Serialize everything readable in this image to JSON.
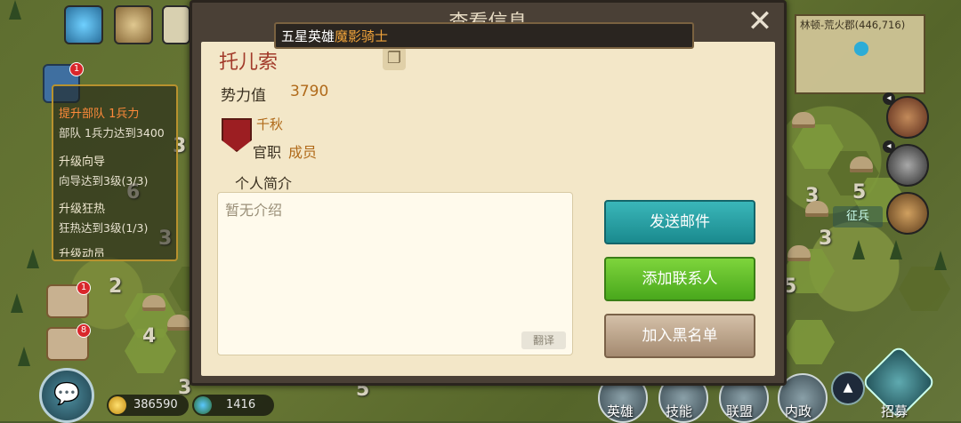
{
  "map": {
    "minimap_title": "林顿-荒火郡(446,716)",
    "tile_numbers": [
      "3",
      "6",
      "3",
      "2",
      "4",
      "3",
      "5",
      "3",
      "5",
      "5",
      "3"
    ],
    "recruit_tag": "征兵"
  },
  "quests": {
    "items": [
      {
        "title": "提升部队 1兵力",
        "detail": "部队 1兵力达到3400"
      },
      {
        "title": "升级向导",
        "detail": "向导达到3级(3/3)"
      },
      {
        "title": "升级狂热",
        "detail": "狂热达到3级(1/3)"
      },
      {
        "title": "升级动员",
        "detail": ""
      }
    ],
    "badge_count": "1"
  },
  "side": {
    "mail_badge": "1",
    "battle_badge": "8"
  },
  "resources": {
    "gold": "386590",
    "gems": "1416"
  },
  "bottom_bar": {
    "hero": "英雄",
    "skill": "技能",
    "alliance": "联盟",
    "internal": "内政",
    "recruit": "招募"
  },
  "dialog": {
    "title": "查看信息",
    "close": "✕",
    "name_bar_prefix": "五星英雄",
    "name_bar_highlight": "魔影骑士",
    "player_name": "托儿索",
    "power_label": "势力值",
    "power_value": "3790",
    "guild_name": "千秋",
    "rank_label": "官职",
    "rank_value": "成员",
    "intro_label": "个人简介",
    "intro_text": "暂无介绍",
    "translate": "翻译",
    "send_mail": "发送邮件",
    "add_contact": "添加联系人",
    "blacklist": "加入黑名单"
  },
  "colors": {
    "accent_orange": "#b06a1a",
    "mail_button": "#1a8a8e",
    "add_button": "#49a81c",
    "black_button": "#a48a70",
    "name_red": "#a23a2a"
  }
}
